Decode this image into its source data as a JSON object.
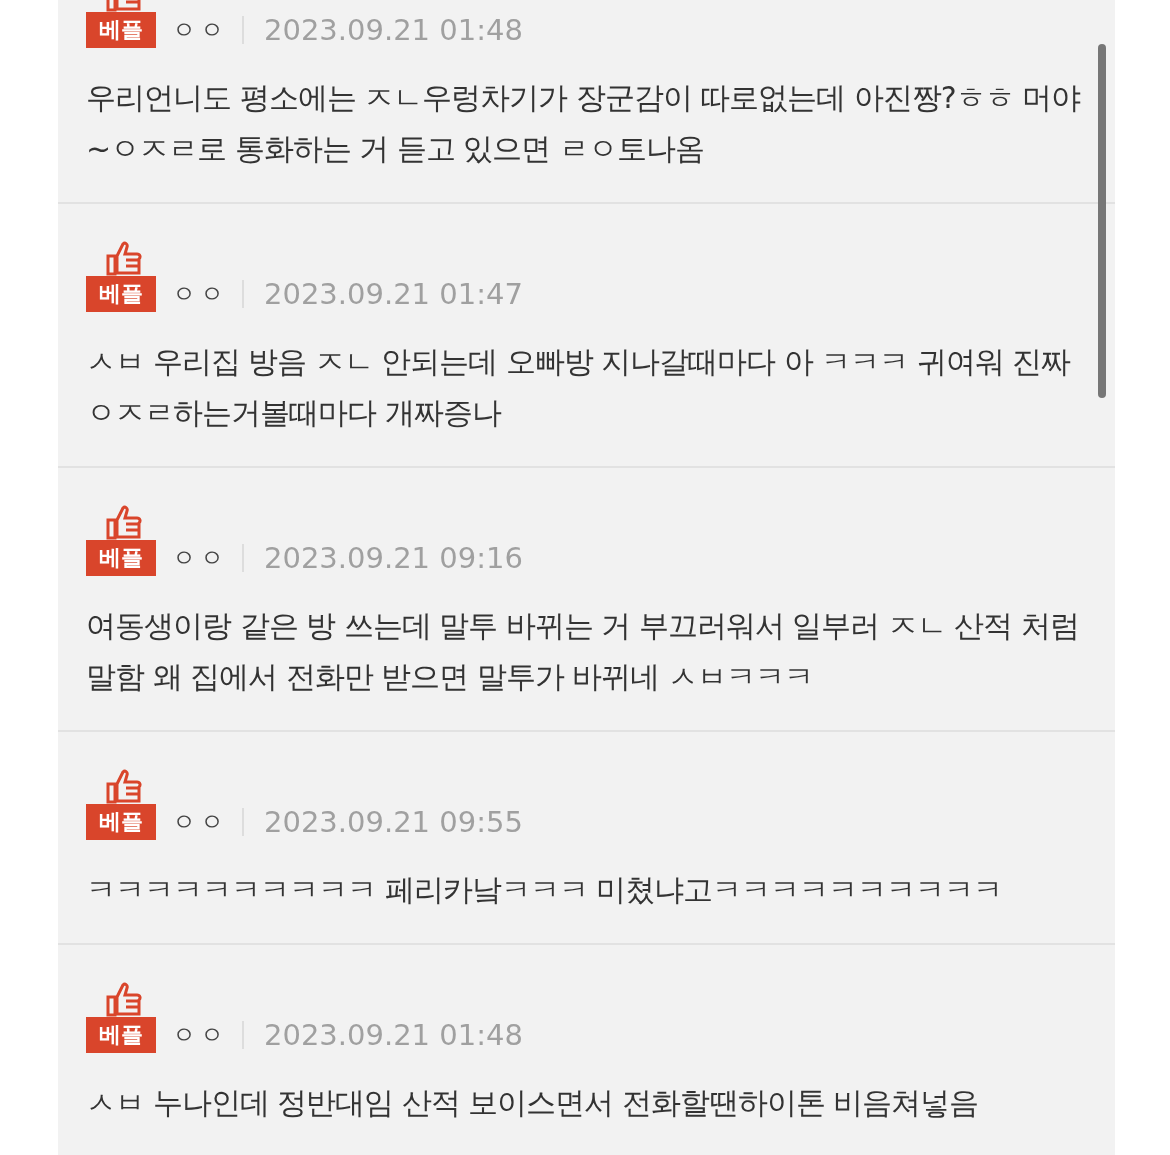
{
  "comments": [
    {
      "badge": "베플",
      "name": "ㅇㅇ",
      "date": "2023.09.21 01:48",
      "text": "우리언니도 평소에는 ㅈㄴ우렁차기가 장군감이 따로없는데 아진짱?ㅎㅎ 머야~ㅇㅈㄹ로 통화하는 거 듣고 있으면 ㄹㅇ토나옴"
    },
    {
      "badge": "베플",
      "name": "ㅇㅇ",
      "date": "2023.09.21 01:47",
      "text": "ㅅㅂ 우리집 방음 ㅈㄴ 안되는데 오빠방 지나갈때마다 아 ㅋㅋㅋ 귀여워 진짜 ㅇㅈㄹ하는거볼때마다 개짜증나"
    },
    {
      "badge": "베플",
      "name": "ㅇㅇ",
      "date": "2023.09.21 09:16",
      "text": "여동생이랑 같은 방 쓰는데 말투 바뀌는 거 부끄러워서 일부러 ㅈㄴ 산적 처럼 말함 왜 집에서 전화만 받으면 말투가 바뀌네 ㅅㅂㅋㅋㅋ"
    },
    {
      "badge": "베플",
      "name": "ㅇㅇ",
      "date": "2023.09.21 09:55",
      "text": "ㅋㅋㅋㅋㅋㅋㅋㅋㅋㅋ 페리카낰ㅋㅋㅋ 미쳤냐고ㅋㅋㅋㅋㅋㅋㅋㅋㅋㅋ"
    },
    {
      "badge": "베플",
      "name": "ㅇㅇ",
      "date": "2023.09.21 01:48",
      "text": "ㅅㅂ 누나인데 정반대임 산적 보이스면서 전화할땐하이톤 비음쳐넣음"
    }
  ]
}
